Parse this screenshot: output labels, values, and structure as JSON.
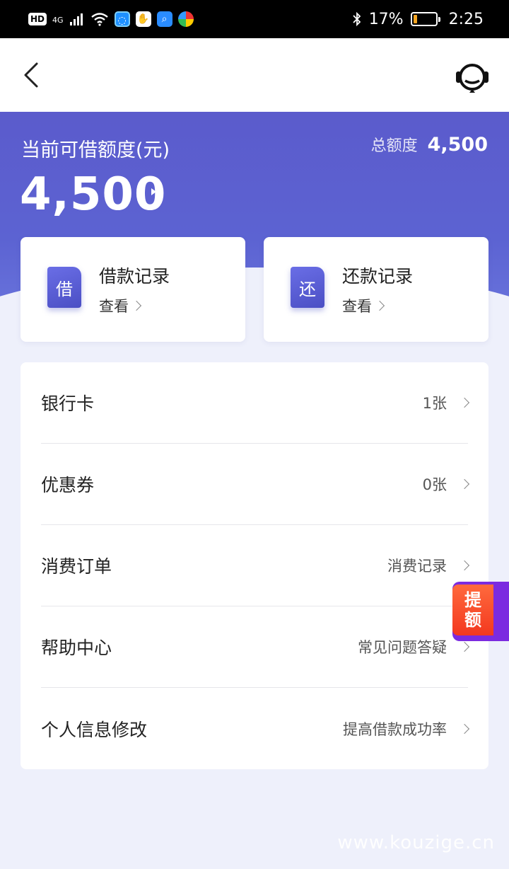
{
  "status_bar": {
    "hd": "HD",
    "network": "4G",
    "battery": "17%",
    "battery_level": 0.17,
    "time": "2:25",
    "apps": [
      "app-icon-blue",
      "app-icon-hand",
      "app-icon-search",
      "app-icon-multicolor"
    ]
  },
  "nav": {
    "back_icon": "chevron-left-icon",
    "service_icon": "headset-icon"
  },
  "hero": {
    "title": "当前可借额度(元)",
    "total_label": "总额度",
    "total_value": "4,500",
    "amount": "4,500"
  },
  "cards": {
    "loan": {
      "icon_char": "借",
      "title": "借款记录",
      "sub": "查看"
    },
    "repay": {
      "icon_char": "还",
      "title": "还款记录",
      "sub": "查看"
    }
  },
  "menu": {
    "items": [
      {
        "label": "银行卡",
        "value": "1张"
      },
      {
        "label": "优惠券",
        "value": "0张"
      },
      {
        "label": "消费订单",
        "value": "消费记录"
      },
      {
        "label": "帮助中心",
        "value": "常见问题答疑"
      },
      {
        "label": "个人信息修改",
        "value": "提高借款成功率"
      }
    ]
  },
  "float_tag": {
    "line1": "提",
    "line2": "额"
  },
  "watermark": "www.kouzige.cn",
  "colors": {
    "hero": "#5b5bcc",
    "accent_icon": "#5a5ed8",
    "float_tag": "#f3381f",
    "background": "#eef0fb"
  }
}
